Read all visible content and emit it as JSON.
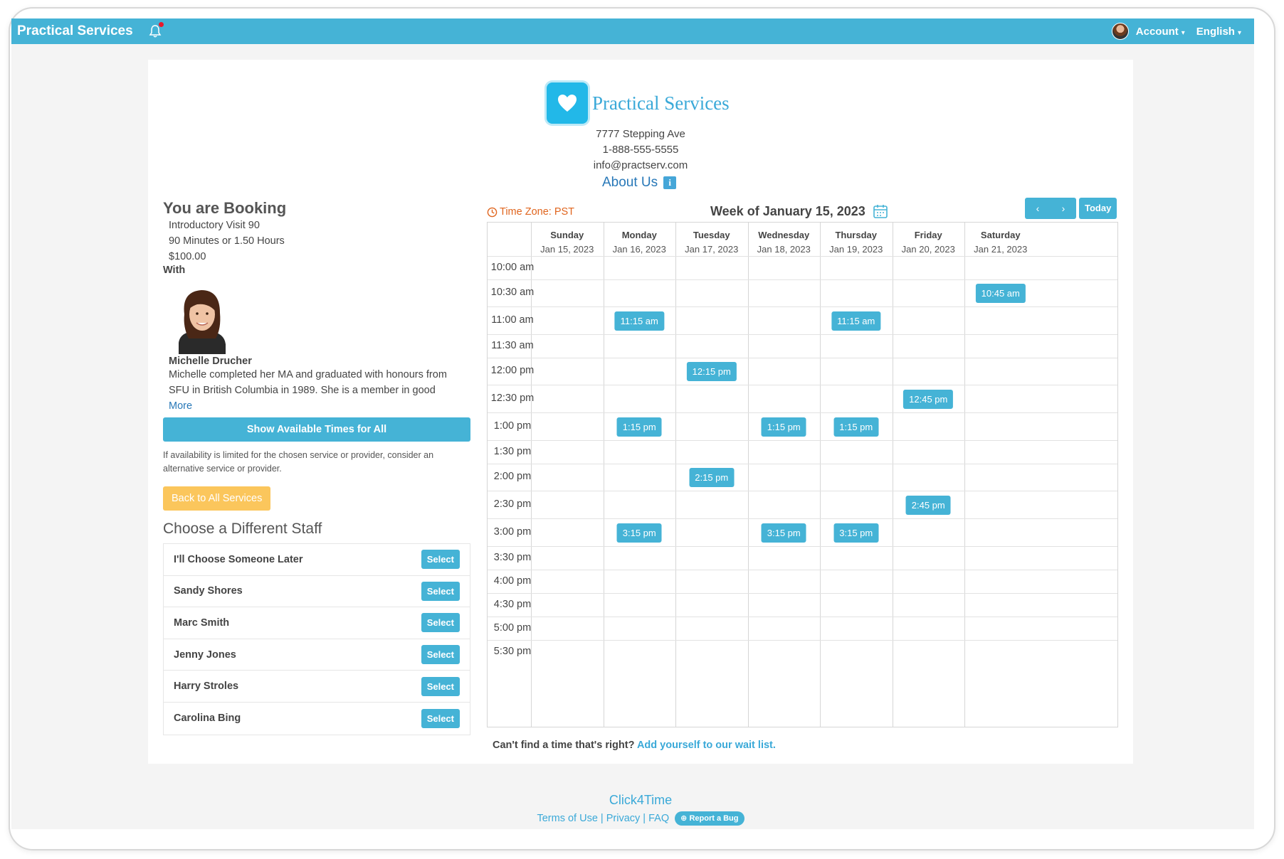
{
  "topbar": {
    "brand": "Practical Services",
    "account_label": "Account",
    "language_label": "English"
  },
  "business": {
    "name": "Practical Services",
    "address": "7777 Stepping Ave",
    "phone": "1-888-555-5555",
    "email": "info@practserv.com",
    "about_label": "About Us",
    "about_icon": "i"
  },
  "booking": {
    "heading": "You are Booking",
    "service": "Introductory Visit 90",
    "duration": "90 Minutes or 1.50 Hours",
    "price": "$100.00",
    "with_label": "With",
    "staff_name": "Michelle Drucher",
    "staff_bio": "Michelle completed her MA and graduated with honours from SFU in British Columbia in 1989. She is a member in good",
    "more_label": "More",
    "show_all_label": "Show Available Times for All",
    "note": "If availability is limited for the chosen service or provider, consider an alternative service or provider.",
    "back_label": "Back to All Services",
    "choose_heading": "Choose a Different Staff",
    "select_label": "Select",
    "staff_options": [
      "I'll Choose Someone Later",
      "Sandy Shores",
      "Marc Smith",
      "Jenny Jones",
      "Harry Stroles",
      "Carolina Bing"
    ]
  },
  "calendar": {
    "timezone": "Time Zone: PST",
    "week_title": "Week of January 15, 2023",
    "prev_icon": "‹",
    "next_icon": "›",
    "today_label": "Today",
    "days": [
      {
        "name": "Sunday",
        "date": "Jan 15, 2023"
      },
      {
        "name": "Monday",
        "date": "Jan 16, 2023"
      },
      {
        "name": "Tuesday",
        "date": "Jan 17, 2023"
      },
      {
        "name": "Wednesday",
        "date": "Jan 18, 2023"
      },
      {
        "name": "Thursday",
        "date": "Jan 19, 2023"
      },
      {
        "name": "Friday",
        "date": "Jan 20, 2023"
      },
      {
        "name": "Saturday",
        "date": "Jan 21, 2023"
      }
    ],
    "times": [
      "10:00 am",
      "10:30 am",
      "11:00 am",
      "11:30 am",
      "12:00 pm",
      "12:30 pm",
      "1:00 pm",
      "1:30 pm",
      "2:00 pm",
      "2:30 pm",
      "3:00 pm",
      "3:30 pm",
      "4:00 pm",
      "4:30 pm",
      "5:00 pm",
      "5:30 pm"
    ],
    "slots": [
      {
        "day": 6,
        "row": 1,
        "label": "10:45 am"
      },
      {
        "day": 1,
        "row": 2,
        "label": "11:15 am"
      },
      {
        "day": 4,
        "row": 2,
        "label": "11:15 am"
      },
      {
        "day": 2,
        "row": 4,
        "label": "12:15 pm"
      },
      {
        "day": 5,
        "row": 5,
        "label": "12:45 pm"
      },
      {
        "day": 1,
        "row": 6,
        "label": "1:15 pm"
      },
      {
        "day": 3,
        "row": 6,
        "label": "1:15 pm"
      },
      {
        "day": 4,
        "row": 6,
        "label": "1:15 pm"
      },
      {
        "day": 2,
        "row": 8,
        "label": "2:15 pm"
      },
      {
        "day": 5,
        "row": 9,
        "label": "2:45 pm"
      },
      {
        "day": 1,
        "row": 10,
        "label": "3:15 pm"
      },
      {
        "day": 3,
        "row": 10,
        "label": "3:15 pm"
      },
      {
        "day": 4,
        "row": 10,
        "label": "3:15 pm"
      }
    ],
    "waitlist_text": "Can't find a time that's right?",
    "waitlist_link": "Add yourself to our wait list."
  },
  "footer": {
    "brand": "Click4Time",
    "terms": "Terms of Use",
    "privacy": "Privacy",
    "faq": "FAQ",
    "bug_label": "Report a Bug"
  }
}
